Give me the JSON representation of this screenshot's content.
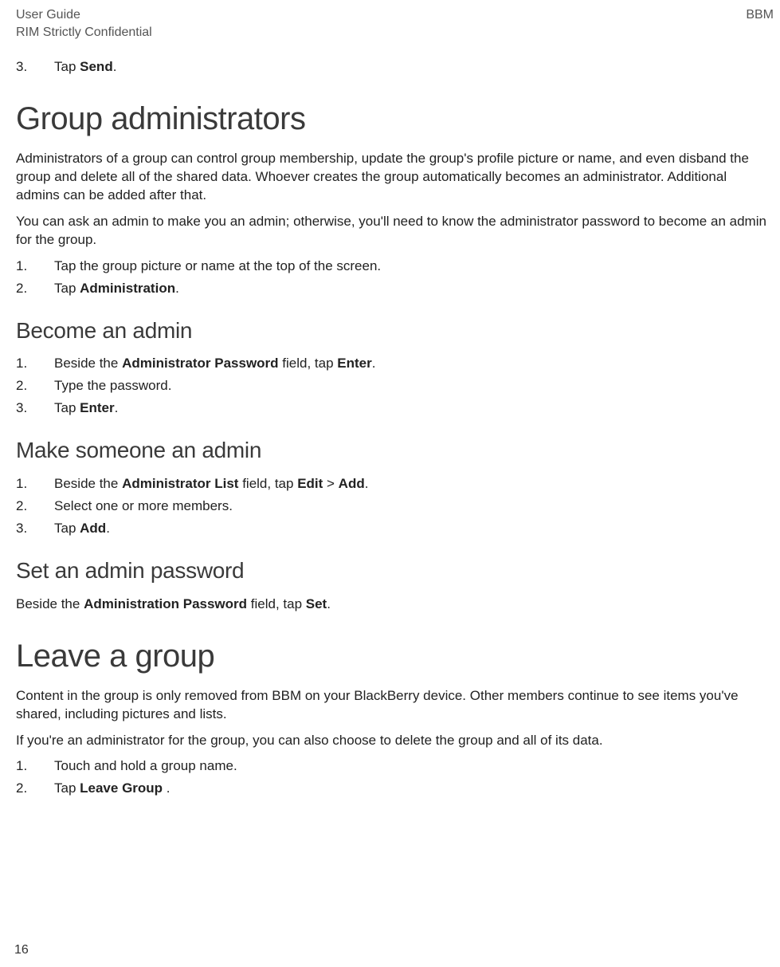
{
  "header": {
    "left1": "User Guide",
    "left2": "RIM Strictly Confidential",
    "right": "BBM"
  },
  "intro": {
    "step3_num": "3.",
    "step3_prefix": "Tap ",
    "step3_bold": "Send",
    "step3_suffix": "."
  },
  "section1": {
    "title": "Group administrators",
    "para1": "Administrators of a group can control group membership, update the group's profile picture or name, and even disband the group and delete all of the shared data. Whoever creates the group automatically becomes an administrator. Additional admins can be added after that.",
    "para2": "You can ask an admin to make you an admin; otherwise, you'll need to know the administrator password to become an admin for the group.",
    "step1_num": "1.",
    "step1_text": "Tap the group picture or name at the top of the screen.",
    "step2_num": "2.",
    "step2_prefix": "Tap ",
    "step2_bold": "Administration",
    "step2_suffix": "."
  },
  "section2": {
    "title": "Become an admin",
    "step1_num": "1.",
    "step1_prefix": "Beside the ",
    "step1_bold1": "Administrator Password",
    "step1_mid": " field, tap ",
    "step1_bold2": "Enter",
    "step1_suffix": ".",
    "step2_num": "2.",
    "step2_text": "Type the password.",
    "step3_num": "3.",
    "step3_prefix": "Tap ",
    "step3_bold": "Enter",
    "step3_suffix": "."
  },
  "section3": {
    "title": "Make someone an admin",
    "step1_num": "1.",
    "step1_prefix": "Beside the ",
    "step1_bold1": "Administrator List",
    "step1_mid1": " field, tap ",
    "step1_bold2": "Edit",
    "step1_sep": " > ",
    "step1_bold3": "Add",
    "step1_suffix": ".",
    "step2_num": "2.",
    "step2_text": "Select one or more members.",
    "step3_num": "3.",
    "step3_prefix": "Tap ",
    "step3_bold": "Add",
    "step3_suffix": "."
  },
  "section4": {
    "title": "Set an admin password",
    "para_prefix": "Beside the ",
    "para_bold1": "Administration Password",
    "para_mid": " field, tap ",
    "para_bold2": "Set",
    "para_suffix": "."
  },
  "section5": {
    "title": "Leave a group",
    "para1": "Content in the group is only removed from BBM on your BlackBerry device. Other members continue to see items you've shared, including pictures and lists.",
    "para2": "If you're an administrator for the group, you can also choose to delete the group and all of its data.",
    "step1_num": "1.",
    "step1_text": "Touch and hold a group name.",
    "step2_num": "2.",
    "step2_prefix": "Tap ",
    "step2_bold": "Leave Group ",
    "step2_suffix": "."
  },
  "pageNumber": "16"
}
